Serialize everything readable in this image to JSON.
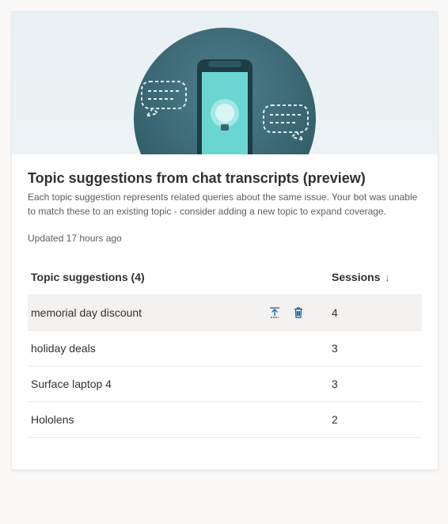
{
  "hero": {
    "alt": "Phone with lightbulb and chat bubbles illustration"
  },
  "title": "Topic suggestions from chat transcripts (preview)",
  "description": "Each topic suggestion represents related queries about the same issue. Your bot was unable to match these to an existing topic - consider adding a new topic to expand coverage.",
  "updated": "Updated 17 hours ago",
  "columns": {
    "name": "Topic suggestions (4)",
    "sessions": "Sessions"
  },
  "sort": {
    "direction": "↓"
  },
  "rows": [
    {
      "name": "memorial day discount",
      "sessions": 4,
      "hover": true
    },
    {
      "name": "holiday deals",
      "sessions": 3,
      "hover": false
    },
    {
      "name": "Surface laptop 4",
      "sessions": 3,
      "hover": false
    },
    {
      "name": "Hololens",
      "sessions": 2,
      "hover": false
    }
  ],
  "icons": {
    "add": "add-to-topics-icon",
    "delete": "delete-icon"
  }
}
